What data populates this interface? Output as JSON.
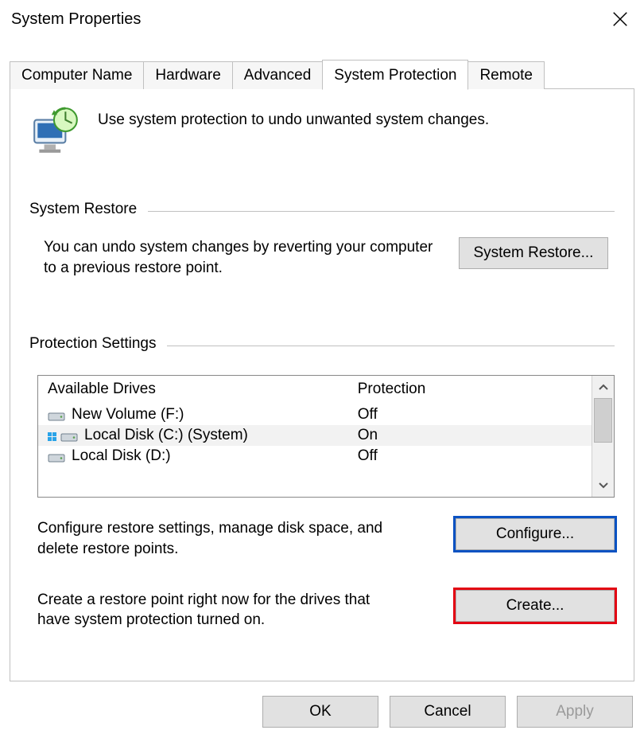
{
  "window": {
    "title": "System Properties"
  },
  "tabs": {
    "items": [
      {
        "label": "Computer Name",
        "active": false
      },
      {
        "label": "Hardware",
        "active": false
      },
      {
        "label": "Advanced",
        "active": false
      },
      {
        "label": "System Protection",
        "active": true
      },
      {
        "label": "Remote",
        "active": false
      }
    ]
  },
  "intro": {
    "text": "Use system protection to undo unwanted system changes.",
    "icon": "system-protection-icon"
  },
  "groups": {
    "system_restore": {
      "title": "System Restore",
      "description": "You can undo system changes by reverting your computer to a previous restore point.",
      "button_label": "System Restore..."
    },
    "protection_settings": {
      "title": "Protection Settings",
      "columns": {
        "drive": "Available Drives",
        "protection": "Protection"
      },
      "drives": [
        {
          "name": "New Volume (F:)",
          "protection": "Off",
          "system": false,
          "selected": false
        },
        {
          "name": "Local Disk (C:) (System)",
          "protection": "On",
          "system": true,
          "selected": true
        },
        {
          "name": "Local Disk (D:)",
          "protection": "Off",
          "system": false,
          "selected": false
        }
      ],
      "configure": {
        "description": "Configure restore settings, manage disk space, and delete restore points.",
        "button_label": "Configure...",
        "highlight": "blue"
      },
      "create": {
        "description": "Create a restore point right now for the drives that have system protection turned on.",
        "button_label": "Create...",
        "highlight": "red"
      }
    }
  },
  "dialog_buttons": {
    "ok": "OK",
    "cancel": "Cancel",
    "apply": "Apply"
  }
}
